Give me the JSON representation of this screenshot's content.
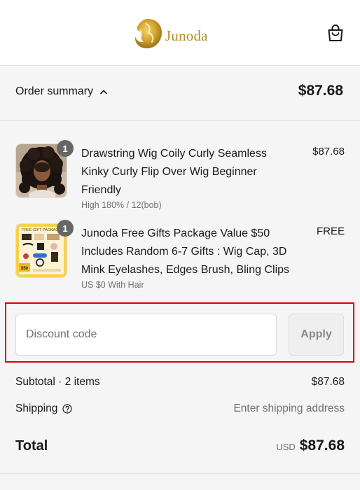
{
  "brand": {
    "name": "Junoda",
    "gold": "#b88d24"
  },
  "cart": {
    "icon": "shopping-bag-icon"
  },
  "summary": {
    "label": "Order summary",
    "total": "$87.68"
  },
  "items": [
    {
      "quantity": "1",
      "title": "Drawstring Wig Coily Curly Seamless Kinky Curly Flip Over Wig Beginner Friendly",
      "variant": "High 180% / 12(bob)",
      "price": "$87.68"
    },
    {
      "quantity": "1",
      "title": "Junoda Free Gifts Package Value $50 Includes Random 6-7 Gifts : Wig Cap, 3D Mink Eyelashes, Edges Brush, Bling Clips",
      "variant": "US $0 With Hair",
      "price": "FREE",
      "thumb_banner": "FREE GIFT PACKAGE",
      "thumb_tag": "$50"
    }
  ],
  "discount": {
    "placeholder": "Discount code",
    "apply_label": "Apply",
    "highlight_color": "#e00000"
  },
  "totals": {
    "subtotal_label": "Subtotal · 2 items",
    "subtotal_value": "$87.68",
    "shipping_label": "Shipping",
    "shipping_value": "Enter shipping address",
    "total_label": "Total",
    "currency": "USD",
    "total_value": "$87.68"
  }
}
